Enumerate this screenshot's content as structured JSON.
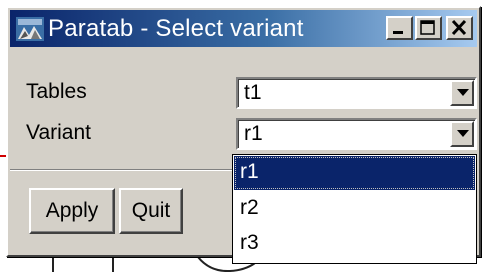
{
  "window": {
    "title": "Paratab - Select variant",
    "title_buttons": [
      "minimize",
      "maximize",
      "close"
    ]
  },
  "form": {
    "tables_label": "Tables",
    "tables_value": "t1",
    "variant_label": "Variant",
    "variant_value": "r1"
  },
  "buttons": {
    "apply": "Apply",
    "quit": "Quit"
  },
  "dropdown": {
    "options": [
      "r1",
      "r2",
      "r3"
    ],
    "selected": "r1"
  },
  "colors": {
    "title_gradient_start": "#0a246a",
    "title_gradient_end": "#a6caf0",
    "face": "#d4d0c8",
    "selection": "#0a246a"
  }
}
